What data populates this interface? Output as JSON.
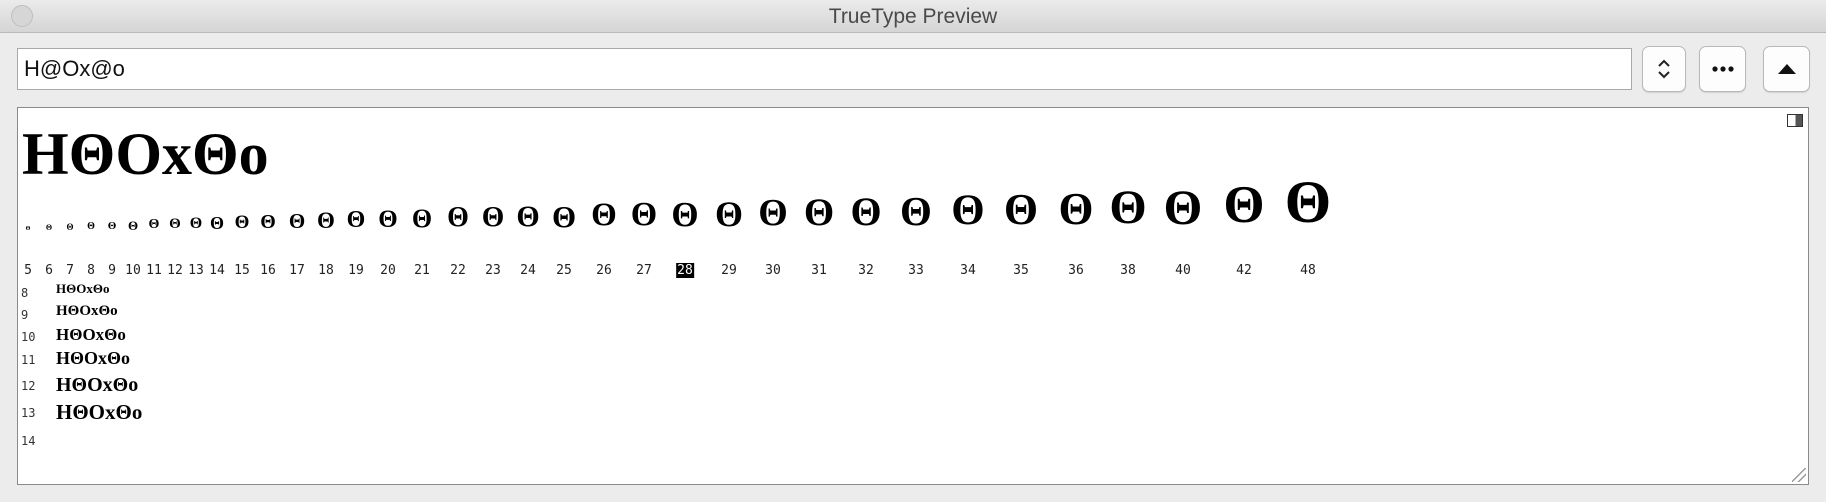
{
  "window": {
    "title": "TrueType Preview"
  },
  "toolbar": {
    "sample_text": "H@Ox@o",
    "stepper_icon": "up-down-chevron-icon",
    "more_icon": "ellipsis-icon",
    "up_icon": "triangle-up-icon"
  },
  "preview": {
    "big_sample": "HΘOxΘo",
    "waterfall_glyph": "Θ",
    "sizes": [
      "5",
      "6",
      "7",
      "8",
      "9",
      "10",
      "11",
      "12",
      "13",
      "14",
      "15",
      "16",
      "17",
      "18",
      "19",
      "20",
      "21",
      "22",
      "23",
      "24",
      "25",
      "26",
      "27",
      "28",
      "29",
      "30",
      "31",
      "32",
      "33",
      "34",
      "35",
      "36",
      "38",
      "40",
      "42",
      "48"
    ],
    "selected_size": "28",
    "sample_rows": [
      {
        "size": "8",
        "text": "HΘOxΘo"
      },
      {
        "size": "9",
        "text": "HΘOxΘo"
      },
      {
        "size": "10",
        "text": "HΘOxΘo"
      },
      {
        "size": "11",
        "text": "HΘOxΘo"
      },
      {
        "size": "12",
        "text": "HΘOxΘo"
      },
      {
        "size": "13",
        "text": "HΘOxΘo"
      },
      {
        "size": "14",
        "text": ""
      }
    ]
  }
}
